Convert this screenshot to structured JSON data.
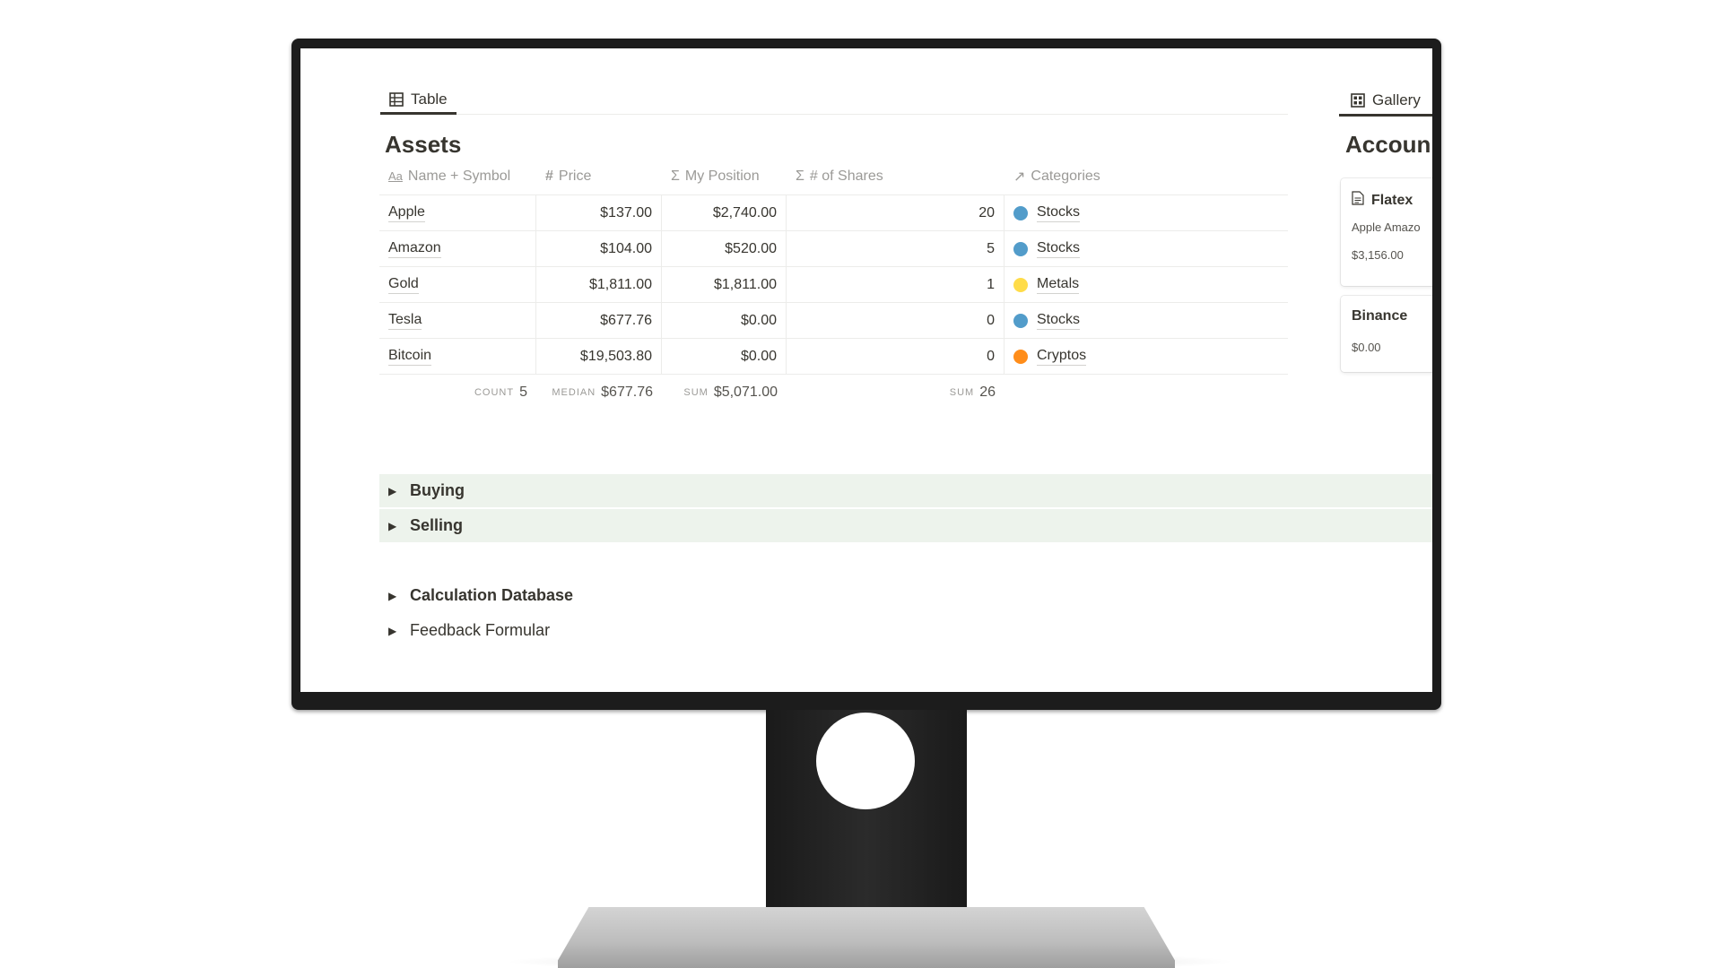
{
  "tabs": {
    "table_label": "Table",
    "gallery_label": "Gallery"
  },
  "assets": {
    "title": "Assets",
    "columns": {
      "name": "Name + Symbol",
      "price": "Price",
      "position": "My Position",
      "shares": "# of Shares",
      "categories": "Categories"
    },
    "rows": [
      {
        "name": "Apple",
        "price": "$137.00",
        "position": "$2,740.00",
        "shares": "20",
        "category": "Stocks",
        "color": "#529cca"
      },
      {
        "name": "Amazon",
        "price": "$104.00",
        "position": "$520.00",
        "shares": "5",
        "category": "Stocks",
        "color": "#529cca"
      },
      {
        "name": "Gold",
        "price": "$1,811.00",
        "position": "$1,811.00",
        "shares": "1",
        "category": "Metals",
        "color": "#ffdc49"
      },
      {
        "name": "Tesla",
        "price": "$677.76",
        "position": "$0.00",
        "shares": "0",
        "category": "Stocks",
        "color": "#529cca"
      },
      {
        "name": "Bitcoin",
        "price": "$19,503.80",
        "position": "$0.00",
        "shares": "0",
        "category": "Cryptos",
        "color": "#ff8d1a"
      }
    ],
    "footer": {
      "count_label": "COUNT",
      "count_value": "5",
      "median_label": "MEDIAN",
      "median_value": "$677.76",
      "sum_pos_label": "SUM",
      "sum_pos_value": "$5,071.00",
      "sum_shares_label": "SUM",
      "sum_shares_value": "26"
    }
  },
  "accounts": {
    "title": "Accoun",
    "cards": [
      {
        "title": "Flatex",
        "sub": "Apple Amazo",
        "value": "$3,156.00"
      },
      {
        "title": "Binance",
        "value": "$0.00"
      }
    ]
  },
  "toggles": {
    "buying": "Buying",
    "selling": "Selling",
    "calc_db": "Calculation Database",
    "feedback": "Feedback Formular"
  },
  "colors": {
    "toggle_bg": "#edf3ec",
    "text": "#37352f",
    "muted": "#9b9a97"
  }
}
